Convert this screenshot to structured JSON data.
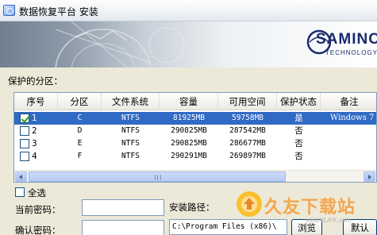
{
  "window": {
    "title": "数据恢复平台 安装"
  },
  "brand": {
    "logo_text": "SAMINC",
    "logo_sub": "TECHNOLOGY"
  },
  "partitions": {
    "label": "保护的分区：",
    "columns": [
      "序号",
      "分区",
      "文件系统",
      "容量",
      "可用空间",
      "保护状态",
      "备注"
    ],
    "rows": [
      {
        "checked": true,
        "index": "1",
        "drive": "C",
        "fs": "NTFS",
        "capacity": "81925MB",
        "free": "59758MB",
        "status": "是",
        "note": "Windows 7"
      },
      {
        "checked": false,
        "index": "2",
        "drive": "D",
        "fs": "NTFS",
        "capacity": "290825MB",
        "free": "287542MB",
        "status": "否",
        "note": ""
      },
      {
        "checked": false,
        "index": "3",
        "drive": "E",
        "fs": "NTFS",
        "capacity": "290825MB",
        "free": "286677MB",
        "status": "否",
        "note": ""
      },
      {
        "checked": false,
        "index": "4",
        "drive": "F",
        "fs": "NTFS",
        "capacity": "290291MB",
        "free": "269897MB",
        "status": "否",
        "note": ""
      }
    ]
  },
  "select_all": {
    "label": "全选"
  },
  "form": {
    "current_password_label": "当前密码：",
    "confirm_password_label": "确认密码：",
    "install_path_label": "安装路径：",
    "install_path_value": "C:\\Program Files (x86)\\",
    "browse_label": "浏览",
    "default_label": "默认"
  },
  "watermark": {
    "text": "久友下载站",
    "url": "www.9UPK.com"
  },
  "colors": {
    "selection": "#316ac5",
    "brand": "#1a2a6e",
    "watermark": "#f59f3f"
  }
}
